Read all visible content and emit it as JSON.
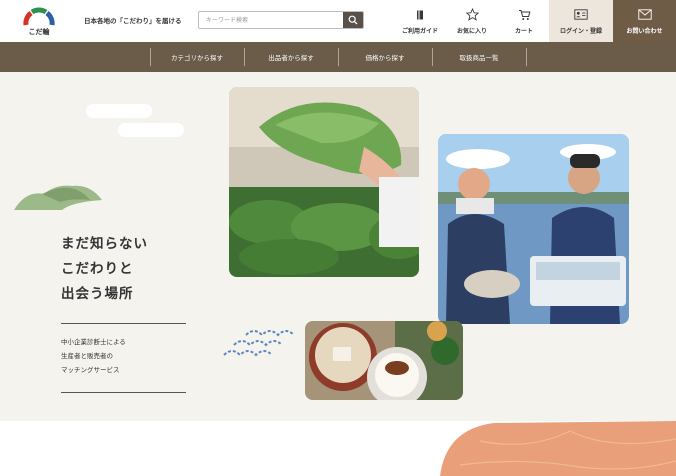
{
  "header": {
    "logo_text": "こだ輪",
    "tagline": "日本各地の「こだわり」を届ける",
    "search": {
      "placeholder": "キーワード検索"
    },
    "nav": {
      "guide": "ご利用ガイド",
      "favorites": "お気に入り",
      "cart": "カート",
      "login": "ログイン・登録",
      "contact": "お問い合わせ"
    }
  },
  "category_nav": [
    "カテゴリから探す",
    "出品者から探す",
    "価格から探す",
    "取扱商品一覧"
  ],
  "hero": {
    "headline": [
      "まだ知らない",
      "こだわりと",
      "出会う場所"
    ],
    "subtext": [
      "中小企業診断士による",
      "生産者と販売者の",
      "マッチングサービス"
    ]
  },
  "colors": {
    "header_bg": "#ffffff",
    "category_bar": "#6a5c48",
    "login_bg": "#ece6dc",
    "contact_bg": "#6e5c46",
    "hero_bg": "#f5f3ee",
    "accent_orange": "#e9a07a",
    "accent_green": "#9cb98a"
  },
  "icons": [
    "logo-icon",
    "search-icon",
    "book-icon",
    "star-icon",
    "cart-icon",
    "id-card-icon",
    "mail-icon"
  ]
}
